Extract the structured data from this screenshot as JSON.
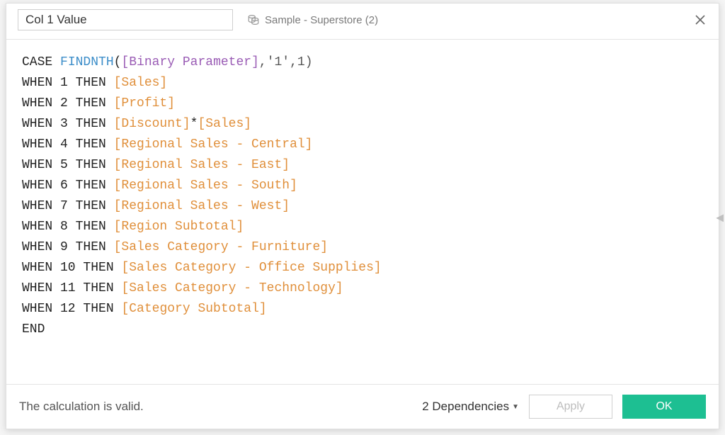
{
  "header": {
    "calc_name": "Col 1 Value",
    "datasource_label": "Sample - Superstore (2)"
  },
  "formula": {
    "func": "FINDNTH",
    "param": "[Binary Parameter]",
    "args_tail": ",'1',1)",
    "end_kw": "END",
    "case_kw": "CASE ",
    "lines": [
      {
        "when": 1,
        "fields": [
          "[Sales]"
        ]
      },
      {
        "when": 2,
        "fields": [
          "[Profit]"
        ]
      },
      {
        "when": 3,
        "fields": [
          "[Discount]",
          "[Sales]"
        ],
        "sep": "*"
      },
      {
        "when": 4,
        "fields": [
          "[Regional Sales - Central]"
        ]
      },
      {
        "when": 5,
        "fields": [
          "[Regional Sales - East]"
        ]
      },
      {
        "when": 6,
        "fields": [
          "[Regional Sales - South]"
        ]
      },
      {
        "when": 7,
        "fields": [
          "[Regional Sales - West]"
        ]
      },
      {
        "when": 8,
        "fields": [
          "[Region Subtotal]"
        ]
      },
      {
        "when": 9,
        "fields": [
          "[Sales Category - Furniture]"
        ]
      },
      {
        "when": 10,
        "fields": [
          "[Sales Category - Office Supplies]"
        ]
      },
      {
        "when": 11,
        "fields": [
          "[Sales Category - Technology]"
        ]
      },
      {
        "when": 12,
        "fields": [
          "[Category Subtotal]"
        ]
      }
    ]
  },
  "footer": {
    "status": "The calculation is valid.",
    "dependencies_label": "2 Dependencies",
    "apply_label": "Apply",
    "ok_label": "OK"
  }
}
